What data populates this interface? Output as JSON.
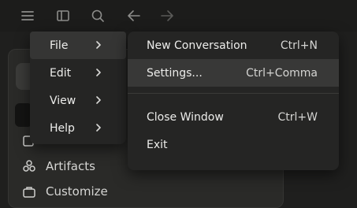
{
  "toolbar": {
    "icons": [
      "hamburger-menu-icon",
      "sidebar-toggle-icon",
      "search-icon",
      "back-arrow-icon",
      "forward-arrow-icon"
    ]
  },
  "sidebar": {
    "artifacts_label": "Artifacts",
    "customize_label": "Customize"
  },
  "menu": {
    "items": [
      {
        "label": "File",
        "active": true
      },
      {
        "label": "Edit",
        "active": false
      },
      {
        "label": "View",
        "active": false
      },
      {
        "label": "Help",
        "active": false
      }
    ]
  },
  "file_submenu": {
    "items": [
      {
        "label": "New Conversation",
        "shortcut": "Ctrl+N"
      },
      {
        "label": "Settings...",
        "shortcut": "Ctrl+Comma"
      },
      {
        "label": "Close Window",
        "shortcut": "Ctrl+W"
      },
      {
        "label": "Exit",
        "shortcut": ""
      }
    ]
  },
  "colors": {
    "background": "#1f1f1e",
    "menu_bg": "#252524",
    "menu_active": "#353534",
    "text": "#ededeb"
  }
}
